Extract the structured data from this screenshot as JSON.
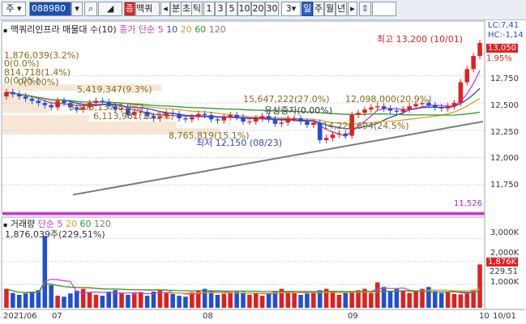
{
  "toolbar": {
    "market": "주",
    "code": "088980",
    "name": "맥쿼",
    "chart_mode_badge": "종",
    "unit_label": "분",
    "tick_label": "초",
    "tick2_label": "틱",
    "intervals": [
      "1",
      "3",
      "5",
      "10",
      "20",
      "30"
    ],
    "interval_value": "3",
    "period_day": "일",
    "period_week": "주",
    "period_month": "월",
    "period_year": "년"
  },
  "price_panel": {
    "title": "맥쿼리인프라 매물대 수(10)",
    "ma_label": "종가 단순",
    "ma_periods": [
      "5",
      "10",
      "20",
      "60",
      "120"
    ],
    "colors": {
      "ma5": "#c83cc8",
      "ma10": "#2a46c8",
      "ma20": "#e0a020",
      "ma60": "#2c9a2c",
      "ma120": "#7a7a7a"
    },
    "lc": "LC:7,41",
    "hc": "HC:-1,14",
    "current_price": "13,050",
    "change_pct": "1.95%",
    "high_label": "최고 13,200 (10/01)",
    "low_label": "최저 12,150 (08/23)",
    "rights_issue": "유상증자(0.00%)",
    "bottom_value": "11,526",
    "y_ticks": [
      "12,750",
      "12,500",
      "12,250",
      "12,000",
      "11,750"
    ],
    "volume_profile": [
      "1,876,039(3.2%)",
      "0(0.0%)",
      "814,718(1.4%)",
      "0(0.0%)",
      "0(0.00%)",
      "5,419,347(9.3%)",
      "5,106,137(8.8%)",
      "6,113,981(10.5%)",
      "8,765,819(15.1%)",
      "15,647,222(27.0%)",
      "12,098,000(20.9%)",
      "14,220,694(24.5%)"
    ]
  },
  "volume_panel": {
    "title": "거래량",
    "ma_label": "단순",
    "ma_periods": [
      "5",
      "20",
      "60",
      "120"
    ],
    "last_volume": "1,876,039주(229,51%)",
    "badge_value": "1,876K",
    "badge_pct": "229.51",
    "y_ticks": [
      "3,000K",
      "2,000K",
      "1,000K"
    ]
  },
  "x_axis": {
    "labels": [
      "2021/06",
      "07",
      "08",
      "09",
      "10"
    ],
    "last_date": "10/01"
  },
  "chart_data": [
    {
      "type": "candlestick",
      "title": "맥쿼리인프라 매물대 수(10)",
      "ylim": [
        11500,
        13250
      ],
      "series": [
        {
          "name": "일봉",
          "close_start": 12600,
          "close_end": 13050,
          "high": 13200,
          "low": 12150
        }
      ]
    },
    {
      "type": "bar",
      "title": "거래량",
      "ylim": [
        0,
        3500
      ],
      "values_k": [
        820,
        640,
        560,
        620,
        700,
        760,
        3100,
        980,
        520,
        480,
        620,
        740,
        820,
        680,
        560,
        520,
        700,
        760,
        640,
        560,
        620,
        680,
        520,
        700,
        760,
        640,
        600,
        520,
        480,
        680,
        760,
        820,
        720,
        560,
        600,
        640,
        700,
        680,
        560,
        620,
        520,
        640,
        720,
        820,
        700,
        640,
        560,
        620,
        680,
        760,
        820,
        700,
        560,
        640,
        700,
        760,
        820,
        640,
        1100,
        900,
        700,
        820,
        760,
        640,
        700,
        820,
        900,
        720,
        640,
        700,
        600,
        580,
        640,
        780,
        1876
      ]
    }
  ]
}
